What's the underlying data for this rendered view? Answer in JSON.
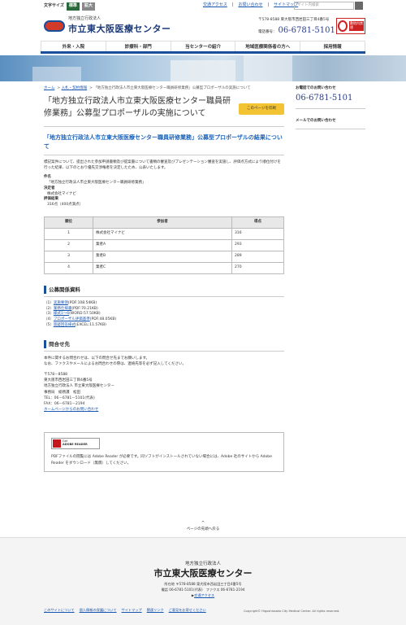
{
  "header": {
    "font_size_label": "文字サイズ",
    "font_size_standard": "標準",
    "font_size_large": "拡大",
    "links": [
      "交通アクセス",
      "お問い合わせ",
      "サイトマップ"
    ],
    "search_placeholder": "サイト内検索",
    "org": "地方独立行政法人",
    "name": "市立東大阪医療センター",
    "address": "〒578-8588 東大阪市西岩田三丁目4番5号",
    "tel_label": "電話番号",
    "tel": "06-6781-5101",
    "nosmoke_label": "敷地内禁煙"
  },
  "gnav": [
    "外来・入院",
    "診療科・部門",
    "当センターの紹介",
    "地域医療関係者の方へ",
    "採用情報"
  ],
  "breadcrumb": {
    "home": "ホーム",
    "sep1": ">",
    "cat": "入札・契約情報",
    "sep2": ">",
    "current": "「地方独立行政法人市立東大阪医療センター職員研修業務」公募型プロポーザルの実施について"
  },
  "page": {
    "title": "「地方独立行政法人市立東大阪医療センター職員研修業務」公募型プロポーザルの実施について",
    "print": "このページを印刷",
    "result_heading": "「地方独立行政法人市立東大阪医療センター職員研修業務」公募型プロポーザルの結果について",
    "result_text": "標記案件について、提出された参加申請書類及び提案書について書類の審査及びプレゼンテーション審査を実施し、評価点方式により順位付けを行った結果、以下のとおり優先交渉権者を決定したため、公表いたします。",
    "dt1": "件名",
    "dd1": "「地方独立行政法人市立東大阪医療センター職員研修業務」",
    "dt2": "決定者",
    "dd2": "株式会社マイナビ",
    "dt3": "評価結果",
    "dd3": "316点（400点満点）"
  },
  "table": {
    "headers": [
      "順位",
      "参加者",
      "得点"
    ],
    "rows": [
      [
        "1",
        "株式会社マイナビ",
        "316"
      ],
      [
        "2",
        "業者A",
        "293"
      ],
      [
        "3",
        "業者B",
        "289"
      ],
      [
        "4",
        "業者C",
        "270"
      ]
    ]
  },
  "docs": {
    "heading": "公募関係資料",
    "items": [
      {
        "num": "（1）",
        "link": "実施要領",
        "suffix": "(PDF:108.54KB)"
      },
      {
        "num": "（2）",
        "link": "業務仕様書",
        "suffix": "(PDF:70.21KB)"
      },
      {
        "num": "（3）",
        "link": "様式1～6",
        "suffix": "(WORD:57.50KB)"
      },
      {
        "num": "（4）",
        "link": "プロポーザル評価基準",
        "suffix": "(PDF:48.05KB)"
      },
      {
        "num": "（5）",
        "link": "質疑回答様式",
        "suffix": "(EXCEL:11.57KB)"
      }
    ]
  },
  "contact": {
    "heading": "問合せ先",
    "text1": "本件に関するお問合わせは、以下の問合せ先までお願いします。",
    "text2": "なお、ファクスやメールによるお問合わせの際は、連絡先等を必ず記入してください。",
    "lines": [
      "〒578－8588",
      "東大阪市西岩田三丁目4番5号",
      "地方独立行政法人 市立東大阪医療センター",
      "事務局　総務課　松田",
      "TEL：06－6781－5101(代表)",
      "FAX：06－6781－2194"
    ],
    "mail_link": "ホームページからのお問い合わせ"
  },
  "adobe": {
    "badge_line1": "Get",
    "badge_line2": "ADOBE READER",
    "text": "PDFファイルの閲覧には Adobe Reader が必要です。同ソフトがインストールされていない場合には、Adobe 社のサイトから Adobe Reader をダウンロード（無償）してください。"
  },
  "side": {
    "tel_label": "お電話でのお問い合わせ",
    "tel": "06-6781-5101",
    "mail_label": "メールでのお問い合わせ"
  },
  "pagetop": {
    "arrow": "^",
    "label": "ページの先頭へ戻る"
  },
  "footer": {
    "org": "地方独立行政法人",
    "name": "市立東大阪医療センター",
    "addr1": "所在地 〒578-8588 東大阪市西岩田三丁目4番5号",
    "addr2": "電話 06-6781-5101(代表)　ファクス 06-6781-2194",
    "addr3": "交通アクセス",
    "links": [
      "このサイトについて",
      "個人情報の保護について",
      "サイトマップ",
      "関連リンク",
      "ご意見をお寄せください"
    ],
    "copyright": "Copyright© Higashiosaka City Medical Center. All rights reserved."
  }
}
